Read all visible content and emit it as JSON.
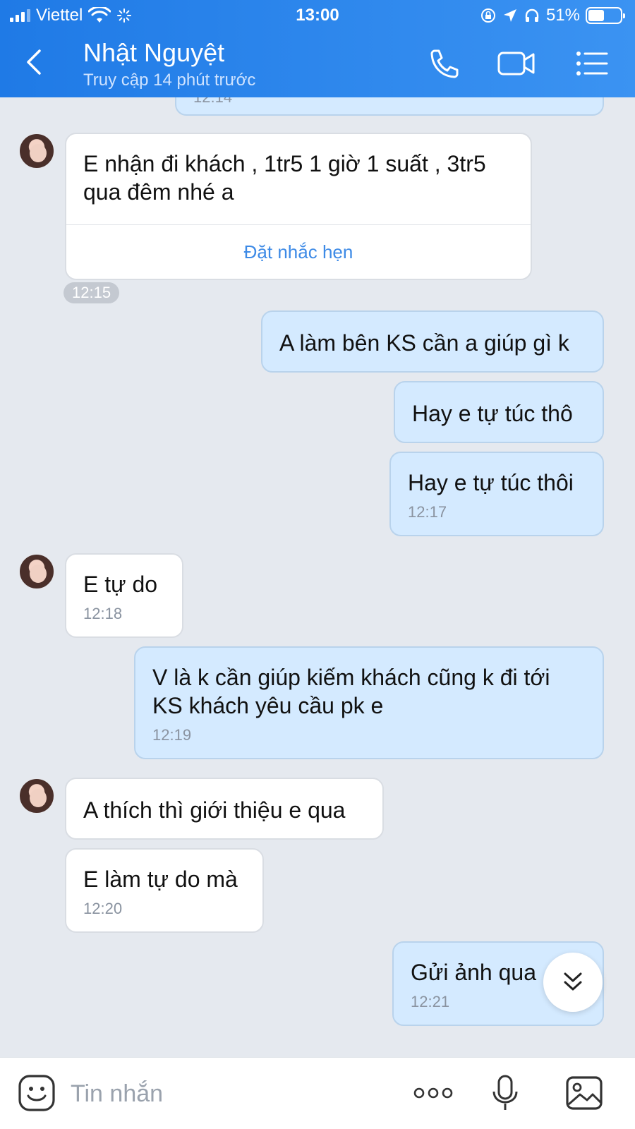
{
  "status_bar": {
    "carrier": "Viettel",
    "time": "13:00",
    "battery_percent": "51%",
    "battery_level": 0.51
  },
  "header": {
    "contact_name": "Nhật Nguyệt",
    "contact_status": "Truy cập 14 phút trước"
  },
  "messages": {
    "prev_time": "12:14",
    "m1": {
      "text": "E nhận đi khách , 1tr5 1 giờ 1 suất , 3tr5 qua đêm nhé a",
      "action": "Đặt nhắc hẹn",
      "time": "12:15"
    },
    "m2": {
      "text": "A làm bên KS cần a giúp gì k"
    },
    "m3": {
      "text": "Hay e tự túc thô"
    },
    "m4": {
      "text": "Hay e tự túc thôi",
      "time": "12:17"
    },
    "m5": {
      "text": "E tự do",
      "time": "12:18"
    },
    "m6": {
      "text": "V là k cần giúp kiếm khách cũng k đi tới KS khách yêu cầu pk e",
      "time": "12:19"
    },
    "m7": {
      "text": "A thích thì giới thiệu e qua"
    },
    "m8": {
      "text": "E làm tự do mà",
      "time": "12:20"
    },
    "m9": {
      "text": "Gửi ảnh qua",
      "time": "12:21"
    }
  },
  "composer": {
    "placeholder": "Tin nhắn"
  },
  "colors": {
    "header": "#2a86ec",
    "outgoing_bubble": "#d4eaff",
    "incoming_bubble": "#ffffff",
    "chat_background": "#e5e9ef",
    "link": "#3d8ae6"
  },
  "icons": [
    "back-arrow-icon",
    "phone-icon",
    "video-call-icon",
    "menu-list-icon",
    "sticker-icon",
    "more-icon",
    "microphone-icon",
    "image-icon",
    "double-chevron-down-icon"
  ]
}
